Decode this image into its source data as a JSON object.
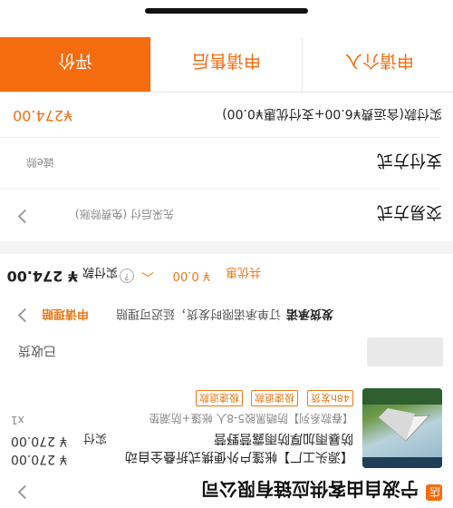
{
  "store": {
    "badge": "店",
    "name": "宁波自由客供应链有限公司"
  },
  "product": {
    "title": "【源头工厂】帐篷户外便携式折叠全自动",
    "subtitle": "防暴雨加厚防雨露营野营",
    "spec": "【春款系列】防晒黑胶5-8人 帐篷+防潮垫",
    "price": "¥ 270.00",
    "paid_label": "实付",
    "paid_amount": "¥ 270.00",
    "qty": "x1",
    "tags": [
      "48h发货",
      "极速退款",
      "极速退款"
    ],
    "status_button": "已收货"
  },
  "guarantee": {
    "label": "发货承诺",
    "text": "订单承诺限时发货，延迟可理赔",
    "link": "申请理赔"
  },
  "summary": {
    "discount_label": "共优惠",
    "discount_value": "¥ 0.00",
    "paid_label": "实付款",
    "paid_value": "¥ 274.00"
  },
  "trade": {
    "label": "交易方式",
    "value": "先采后付 (免费赊账)"
  },
  "payment": {
    "label": "支付方式",
    "value": "诚e赊"
  },
  "payment_detail": {
    "label": "实付款(含运费¥6.00+支付优惠¥0.00)",
    "value": "¥274.00"
  },
  "actions": {
    "intervene": "申请介入",
    "after_sale": "申请售后",
    "review": "评价"
  },
  "colors": {
    "accent": "#f56c0f",
    "price": "#333333",
    "tag": "#e87916",
    "divider": "#ececec"
  }
}
